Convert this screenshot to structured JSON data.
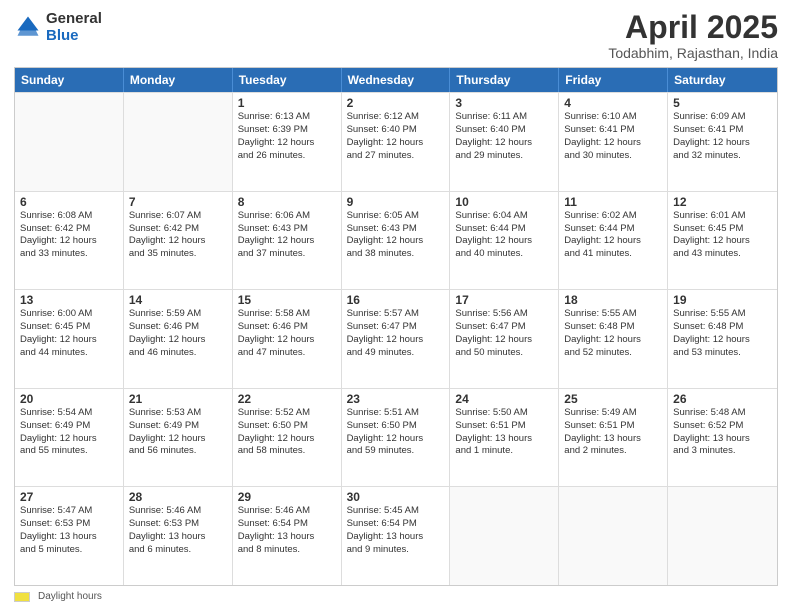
{
  "logo": {
    "line1": "General",
    "line2": "Blue"
  },
  "title": "April 2025",
  "subtitle": "Todabhim, Rajasthan, India",
  "header_days": [
    "Sunday",
    "Monday",
    "Tuesday",
    "Wednesday",
    "Thursday",
    "Friday",
    "Saturday"
  ],
  "weeks": [
    [
      {
        "day": "",
        "info": ""
      },
      {
        "day": "",
        "info": ""
      },
      {
        "day": "1",
        "info": "Sunrise: 6:13 AM\nSunset: 6:39 PM\nDaylight: 12 hours\nand 26 minutes."
      },
      {
        "day": "2",
        "info": "Sunrise: 6:12 AM\nSunset: 6:40 PM\nDaylight: 12 hours\nand 27 minutes."
      },
      {
        "day": "3",
        "info": "Sunrise: 6:11 AM\nSunset: 6:40 PM\nDaylight: 12 hours\nand 29 minutes."
      },
      {
        "day": "4",
        "info": "Sunrise: 6:10 AM\nSunset: 6:41 PM\nDaylight: 12 hours\nand 30 minutes."
      },
      {
        "day": "5",
        "info": "Sunrise: 6:09 AM\nSunset: 6:41 PM\nDaylight: 12 hours\nand 32 minutes."
      }
    ],
    [
      {
        "day": "6",
        "info": "Sunrise: 6:08 AM\nSunset: 6:42 PM\nDaylight: 12 hours\nand 33 minutes."
      },
      {
        "day": "7",
        "info": "Sunrise: 6:07 AM\nSunset: 6:42 PM\nDaylight: 12 hours\nand 35 minutes."
      },
      {
        "day": "8",
        "info": "Sunrise: 6:06 AM\nSunset: 6:43 PM\nDaylight: 12 hours\nand 37 minutes."
      },
      {
        "day": "9",
        "info": "Sunrise: 6:05 AM\nSunset: 6:43 PM\nDaylight: 12 hours\nand 38 minutes."
      },
      {
        "day": "10",
        "info": "Sunrise: 6:04 AM\nSunset: 6:44 PM\nDaylight: 12 hours\nand 40 minutes."
      },
      {
        "day": "11",
        "info": "Sunrise: 6:02 AM\nSunset: 6:44 PM\nDaylight: 12 hours\nand 41 minutes."
      },
      {
        "day": "12",
        "info": "Sunrise: 6:01 AM\nSunset: 6:45 PM\nDaylight: 12 hours\nand 43 minutes."
      }
    ],
    [
      {
        "day": "13",
        "info": "Sunrise: 6:00 AM\nSunset: 6:45 PM\nDaylight: 12 hours\nand 44 minutes."
      },
      {
        "day": "14",
        "info": "Sunrise: 5:59 AM\nSunset: 6:46 PM\nDaylight: 12 hours\nand 46 minutes."
      },
      {
        "day": "15",
        "info": "Sunrise: 5:58 AM\nSunset: 6:46 PM\nDaylight: 12 hours\nand 47 minutes."
      },
      {
        "day": "16",
        "info": "Sunrise: 5:57 AM\nSunset: 6:47 PM\nDaylight: 12 hours\nand 49 minutes."
      },
      {
        "day": "17",
        "info": "Sunrise: 5:56 AM\nSunset: 6:47 PM\nDaylight: 12 hours\nand 50 minutes."
      },
      {
        "day": "18",
        "info": "Sunrise: 5:55 AM\nSunset: 6:48 PM\nDaylight: 12 hours\nand 52 minutes."
      },
      {
        "day": "19",
        "info": "Sunrise: 5:55 AM\nSunset: 6:48 PM\nDaylight: 12 hours\nand 53 minutes."
      }
    ],
    [
      {
        "day": "20",
        "info": "Sunrise: 5:54 AM\nSunset: 6:49 PM\nDaylight: 12 hours\nand 55 minutes."
      },
      {
        "day": "21",
        "info": "Sunrise: 5:53 AM\nSunset: 6:49 PM\nDaylight: 12 hours\nand 56 minutes."
      },
      {
        "day": "22",
        "info": "Sunrise: 5:52 AM\nSunset: 6:50 PM\nDaylight: 12 hours\nand 58 minutes."
      },
      {
        "day": "23",
        "info": "Sunrise: 5:51 AM\nSunset: 6:50 PM\nDaylight: 12 hours\nand 59 minutes."
      },
      {
        "day": "24",
        "info": "Sunrise: 5:50 AM\nSunset: 6:51 PM\nDaylight: 13 hours\nand 1 minute."
      },
      {
        "day": "25",
        "info": "Sunrise: 5:49 AM\nSunset: 6:51 PM\nDaylight: 13 hours\nand 2 minutes."
      },
      {
        "day": "26",
        "info": "Sunrise: 5:48 AM\nSunset: 6:52 PM\nDaylight: 13 hours\nand 3 minutes."
      }
    ],
    [
      {
        "day": "27",
        "info": "Sunrise: 5:47 AM\nSunset: 6:53 PM\nDaylight: 13 hours\nand 5 minutes."
      },
      {
        "day": "28",
        "info": "Sunrise: 5:46 AM\nSunset: 6:53 PM\nDaylight: 13 hours\nand 6 minutes."
      },
      {
        "day": "29",
        "info": "Sunrise: 5:46 AM\nSunset: 6:54 PM\nDaylight: 13 hours\nand 8 minutes."
      },
      {
        "day": "30",
        "info": "Sunrise: 5:45 AM\nSunset: 6:54 PM\nDaylight: 13 hours\nand 9 minutes."
      },
      {
        "day": "",
        "info": ""
      },
      {
        "day": "",
        "info": ""
      },
      {
        "day": "",
        "info": ""
      }
    ]
  ],
  "footer_label": "Daylight hours"
}
